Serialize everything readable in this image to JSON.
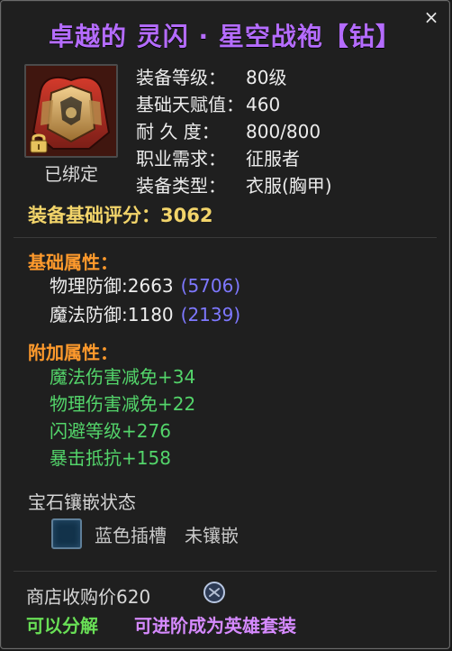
{
  "title": "卓越的 灵闪 · 星空战袍【钻】",
  "close_label": "×",
  "item": {
    "bound_label": "已绑定",
    "attributes": [
      {
        "label": "装备等级：",
        "value": "80级"
      },
      {
        "label": "基础天赋值：",
        "value": "460"
      },
      {
        "label": "耐 久 度：",
        "value": "800/800"
      },
      {
        "label": "职业需求：",
        "value": "征服者"
      },
      {
        "label": "装备类型：",
        "value": "衣服(胸甲)"
      }
    ],
    "score_label": "装备基础评分：",
    "score_value": "3062"
  },
  "basic_attributes": {
    "title": "基础属性：",
    "rows": [
      {
        "name": "物理防御:",
        "value": "2663",
        "alt": "(5706)"
      },
      {
        "name": "魔法防御:",
        "value": "1180",
        "alt": "(2139)"
      }
    ]
  },
  "additional_attributes": {
    "title": "附加属性：",
    "rows": [
      "魔法伤害减免+34",
      "物理伤害减免+22",
      "闪避等级+276",
      "暴击抵抗+158"
    ]
  },
  "gem": {
    "title": "宝石镶嵌状态",
    "slot_name": "蓝色插槽",
    "slot_state": "未镶嵌"
  },
  "shop": {
    "label": "商店收购价",
    "price": "620"
  },
  "footer": {
    "left": "可以分解",
    "right": "可进阶成为英雄套装"
  },
  "colors": {
    "title": "#b56cff",
    "score": "#f2d46a",
    "section": "#ff9a2c",
    "additional": "#53d46a",
    "alt_value": "#7e78ff",
    "footer_left": "#69df56",
    "footer_right": "#d68aff"
  },
  "icons": {
    "item": "armor-icon",
    "lock": "lock-icon",
    "close": "close-icon",
    "coin": "coin-icon"
  }
}
